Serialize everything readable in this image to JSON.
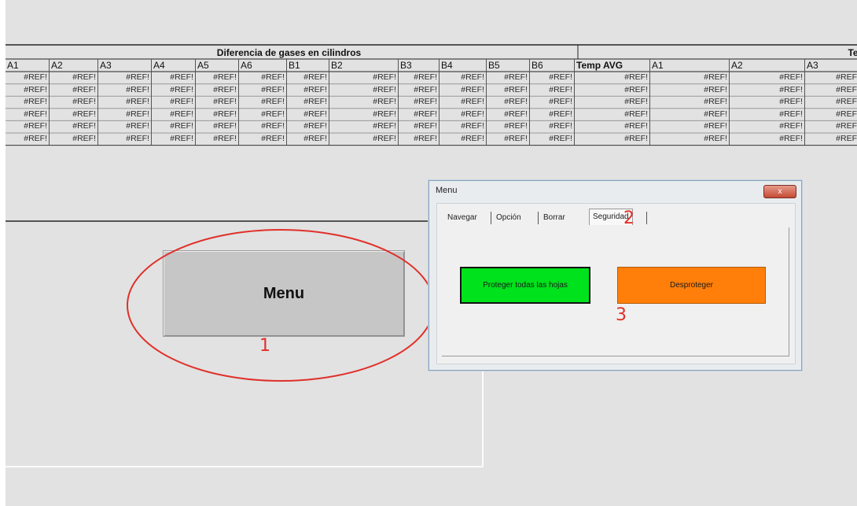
{
  "sheet": {
    "group_header_1": "Diferencia de gases en cilindros",
    "group_header_2": "Te",
    "columns": [
      "A1",
      "A2",
      "A3",
      "A4",
      "A5",
      "A6",
      "B1",
      "B2",
      "B3",
      "B4",
      "B5",
      "B6",
      "Temp AVG",
      "A1",
      "A2",
      "A3"
    ],
    "row_values": [
      [
        "#REF!",
        "#REF!",
        "#REF!",
        "#REF!",
        "#REF!",
        "#REF!",
        "#REF!",
        "#REF!",
        "#REF!",
        "#REF!",
        "#REF!",
        "#REF!",
        "#REF!",
        "#REF!",
        "#REF!",
        "#REF"
      ],
      [
        "#REF!",
        "#REF!",
        "#REF!",
        "#REF!",
        "#REF!",
        "#REF!",
        "#REF!",
        "#REF!",
        "#REF!",
        "#REF!",
        "#REF!",
        "#REF!",
        "#REF!",
        "#REF!",
        "#REF!",
        "#REF"
      ],
      [
        "#REF!",
        "#REF!",
        "#REF!",
        "#REF!",
        "#REF!",
        "#REF!",
        "#REF!",
        "#REF!",
        "#REF!",
        "#REF!",
        "#REF!",
        "#REF!",
        "#REF!",
        "#REF!",
        "#REF!",
        "#REF"
      ],
      [
        "#REF!",
        "#REF!",
        "#REF!",
        "#REF!",
        "#REF!",
        "#REF!",
        "#REF!",
        "#REF!",
        "#REF!",
        "#REF!",
        "#REF!",
        "#REF!",
        "#REF!",
        "#REF!",
        "#REF!",
        "#REF"
      ],
      [
        "#REF!",
        "#REF!",
        "#REF!",
        "#REF!",
        "#REF!",
        "#REF!",
        "#REF!",
        "#REF!",
        "#REF!",
        "#REF!",
        "#REF!",
        "#REF!",
        "#REF!",
        "#REF!",
        "#REF!",
        "#REF"
      ],
      [
        "#REF!",
        "#REF!",
        "#REF!",
        "#REF!",
        "#REF!",
        "#REF!",
        "#REF!",
        "#REF!",
        "#REF!",
        "#REF!",
        "#REF!",
        "#REF!",
        "#REF!",
        "#REF!",
        "#REF!",
        "#REF"
      ]
    ]
  },
  "menu_button": {
    "label": "Menu"
  },
  "dialog": {
    "title": "Menu",
    "close_label": "x",
    "tabs": [
      "Navegar",
      "Opción",
      "Borrar",
      "Seguridad"
    ],
    "protect_label": "Proteger todas las hojas",
    "unprotect_label": "Desproteger"
  },
  "annotations": {
    "n1": "1",
    "n2": "2",
    "n3": "3",
    "color": "#e0302a"
  },
  "colors": {
    "green": "#00e21c",
    "orange": "#ff7f0a",
    "sheet_bg": "#e2e2e2"
  }
}
